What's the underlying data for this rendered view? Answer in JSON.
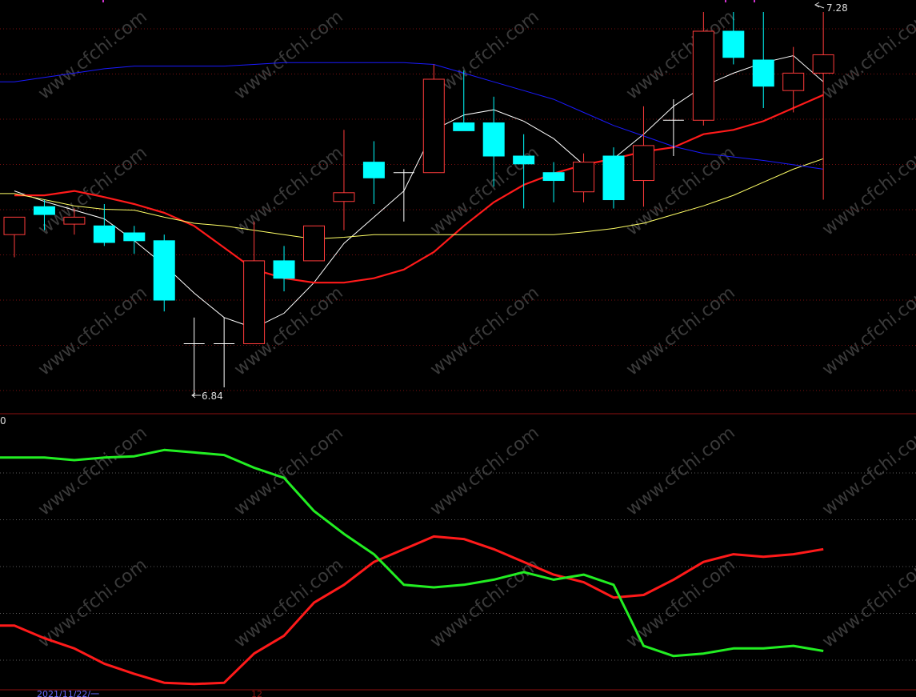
{
  "colors": {
    "background": "#000000",
    "up_candle": "#ff3b3b",
    "down_candle": "#00ffff",
    "ma_short": "#ffffff",
    "ma_mid": "#ff1a1a",
    "ma_long": "#ffff66",
    "ma_xlong": "#1a1aff",
    "grid": "#7a1010",
    "watermark": "#3a3a3a",
    "ind_red": "#ff1a1a",
    "ind_green": "#22ee22",
    "date_text": "#6a6aff"
  },
  "labels": {
    "high_mark": "7.28",
    "low_mark": "6.84",
    "lower_panel_zero": "0",
    "date": "2021/11/22/一",
    "date_tail": "12",
    "watermark": "www.cfchi.com"
  },
  "chart_data": [
    {
      "type": "candlestick",
      "title": "",
      "xlabel": "",
      "ylabel": "",
      "ylim": [
        6.82,
        7.3
      ],
      "grid": true,
      "categories": [
        1,
        2,
        3,
        4,
        5,
        6,
        7,
        8,
        9,
        10,
        11,
        12,
        13,
        14,
        15,
        16,
        17,
        18,
        19,
        20,
        21,
        22,
        23,
        24,
        25,
        26,
        27,
        28
      ],
      "candles": [
        {
          "open": 7.025,
          "high": 7.045,
          "low": 6.999,
          "close": 7.045
        },
        {
          "open": 7.057,
          "high": 7.065,
          "low": 7.03,
          "close": 7.048
        },
        {
          "open": 7.037,
          "high": 7.055,
          "low": 7.025,
          "close": 7.045
        },
        {
          "open": 7.035,
          "high": 7.06,
          "low": 7.012,
          "close": 7.016
        },
        {
          "open": 7.027,
          "high": 7.035,
          "low": 7.003,
          "close": 7.018
        },
        {
          "open": 7.018,
          "high": 7.025,
          "low": 6.937,
          "close": 6.95
        },
        {
          "open": 6.9,
          "high": 6.93,
          "low": 6.84,
          "close": 6.9
        },
        {
          "open": 6.9,
          "high": 6.93,
          "low": 6.85,
          "close": 6.9
        },
        {
          "open": 6.9,
          "high": 7.04,
          "low": 6.9,
          "close": 6.995
        },
        {
          "open": 6.995,
          "high": 7.012,
          "low": 6.96,
          "close": 6.975
        },
        {
          "open": 6.995,
          "high": 7.022,
          "low": 6.995,
          "close": 7.035
        },
        {
          "open": 7.063,
          "high": 7.145,
          "low": 7.03,
          "close": 7.073
        },
        {
          "open": 7.108,
          "high": 7.132,
          "low": 7.06,
          "close": 7.09
        },
        {
          "open": 7.096,
          "high": 7.1,
          "low": 7.04,
          "close": 7.096
        },
        {
          "open": 7.096,
          "high": 7.22,
          "low": 7.096,
          "close": 7.203
        },
        {
          "open": 7.153,
          "high": 7.213,
          "low": 7.145,
          "close": 7.144
        },
        {
          "open": 7.153,
          "high": 7.183,
          "low": 7.08,
          "close": 7.115
        },
        {
          "open": 7.115,
          "high": 7.14,
          "low": 7.055,
          "close": 7.106
        },
        {
          "open": 7.096,
          "high": 7.108,
          "low": 7.062,
          "close": 7.087
        },
        {
          "open": 7.074,
          "high": 7.118,
          "low": 7.062,
          "close": 7.108
        },
        {
          "open": 7.115,
          "high": 7.125,
          "low": 7.055,
          "close": 7.065
        },
        {
          "open": 7.087,
          "high": 7.172,
          "low": 7.057,
          "close": 7.127
        },
        {
          "open": 7.156,
          "high": 7.18,
          "low": 7.115,
          "close": 7.156
        },
        {
          "open": 7.156,
          "high": 7.28,
          "low": 7.15,
          "close": 7.258
        },
        {
          "open": 7.258,
          "high": 7.28,
          "low": 7.22,
          "close": 7.228
        },
        {
          "open": 7.225,
          "high": 7.28,
          "low": 7.17,
          "close": 7.195
        },
        {
          "open": 7.19,
          "high": 7.24,
          "low": 7.165,
          "close": 7.21
        },
        {
          "open": 7.21,
          "high": 7.28,
          "low": 7.065,
          "close": 7.231
        }
      ],
      "series": [
        {
          "key": "ma_short",
          "values": [
            7.075,
            7.063,
            7.053,
            7.043,
            7.018,
            6.99,
            6.958,
            6.93,
            6.918,
            6.935,
            6.97,
            7.015,
            7.045,
            7.075,
            7.145,
            7.162,
            7.168,
            7.155,
            7.135,
            7.105,
            7.112,
            7.14,
            7.172,
            7.195,
            7.21,
            7.222,
            7.23,
            7.2
          ]
        },
        {
          "key": "ma_mid",
          "values": [
            7.07,
            7.07,
            7.075,
            7.068,
            7.06,
            7.05,
            7.035,
            7.01,
            6.985,
            6.975,
            6.97,
            6.97,
            6.975,
            6.985,
            7.005,
            7.035,
            7.062,
            7.082,
            7.095,
            7.105,
            7.112,
            7.12,
            7.125,
            7.14,
            7.145,
            7.155,
            7.17,
            7.185
          ]
        },
        {
          "key": "ma_long",
          "values": [
            7.072,
            7.065,
            7.058,
            7.054,
            7.053,
            7.045,
            7.038,
            7.035,
            7.03,
            7.025,
            7.02,
            7.022,
            7.025,
            7.025,
            7.025,
            7.025,
            7.025,
            7.025,
            7.025,
            7.028,
            7.032,
            7.038,
            7.048,
            7.058,
            7.07,
            7.085,
            7.1,
            7.112
          ]
        },
        {
          "key": "ma_xlong",
          "values": [
            7.2,
            7.205,
            7.21,
            7.215,
            7.218,
            7.218,
            7.218,
            7.218,
            7.22,
            7.222,
            7.222,
            7.222,
            7.222,
            7.222,
            7.22,
            7.21,
            7.2,
            7.19,
            7.18,
            7.165,
            7.15,
            7.138,
            7.126,
            7.118,
            7.114,
            7.11,
            7.105,
            7.1
          ]
        }
      ]
    },
    {
      "type": "line",
      "title": "",
      "xlabel": "",
      "ylabel": "",
      "ylim": [
        0,
        100
      ],
      "grid": true,
      "x": [
        1,
        2,
        3,
        4,
        5,
        6,
        7,
        8,
        9,
        10,
        11,
        12,
        13,
        14,
        15,
        16,
        17,
        18,
        19,
        20,
        21,
        22,
        23,
        24,
        25,
        26,
        27,
        28
      ],
      "series": [
        {
          "key": "ind_red",
          "values": [
            24,
            19,
            15,
            9,
            5,
            1.5,
            1,
            1.5,
            13,
            20,
            33,
            40,
            49,
            54,
            59,
            58,
            54,
            49,
            44,
            41,
            35,
            36,
            42,
            49,
            52,
            51,
            52,
            54
          ]
        },
        {
          "key": "ind_green",
          "values": [
            90,
            90,
            89,
            90,
            90.5,
            93,
            92,
            91,
            86,
            82,
            69,
            60,
            52,
            40,
            39,
            40,
            42,
            45,
            42,
            44,
            40,
            16,
            12,
            13,
            15,
            15,
            16,
            14
          ]
        }
      ]
    }
  ]
}
